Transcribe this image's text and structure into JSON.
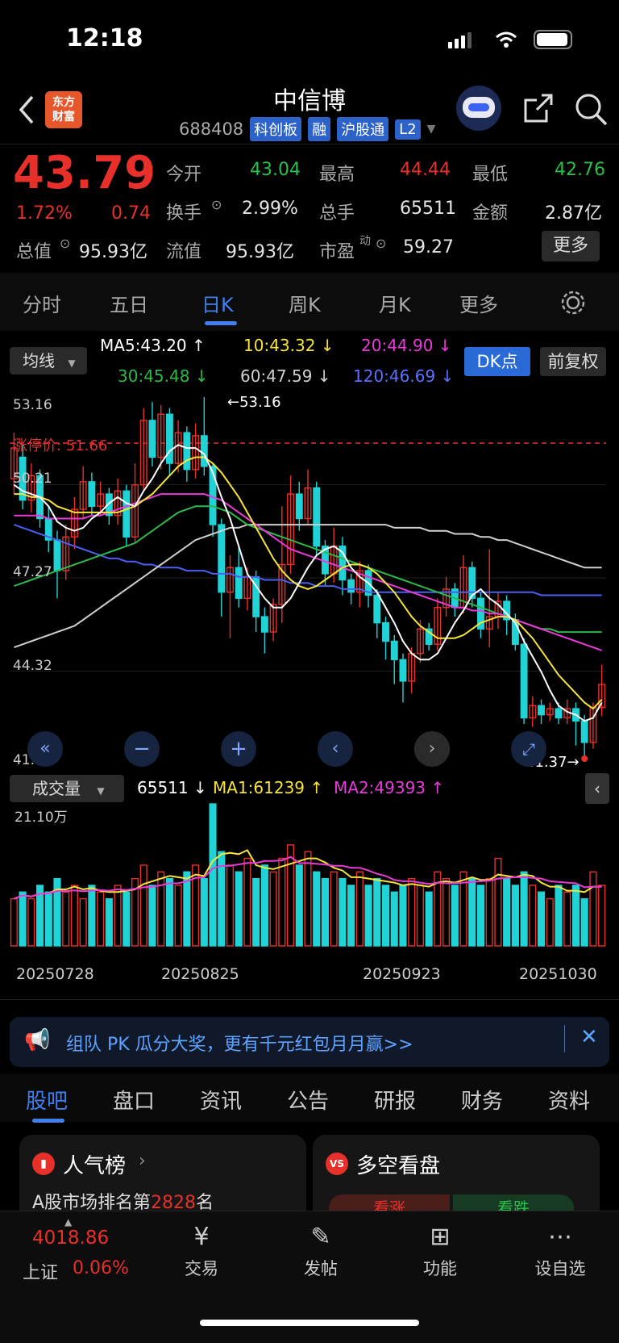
{
  "status": {
    "time": "12:18"
  },
  "header": {
    "title": "中信博",
    "code": "688408",
    "tags": [
      "科创板",
      "融",
      "沪股通",
      "L2"
    ],
    "logo_line1": "东方",
    "logo_line2": "财富"
  },
  "quote": {
    "price": "43.79",
    "change_pct": "1.72%",
    "change_abs": "0.74",
    "open_label": "今开",
    "open": "43.04",
    "high_label": "最高",
    "high": "44.44",
    "low_label": "最低",
    "low": "42.76",
    "turnover_label": "换手",
    "turnover": "2.99%",
    "volume_label": "总手",
    "volume": "65511",
    "amount_label": "金额",
    "amount": "2.87亿",
    "mktcap_label": "总值",
    "mktcap": "95.93亿",
    "float_label": "流值",
    "float": "95.93亿",
    "pe_label": "市盈",
    "pe_sup": "动",
    "pe": "59.27",
    "more_button": "更多"
  },
  "tabs": [
    "分时",
    "五日",
    "日K",
    "周K",
    "月K",
    "更多"
  ],
  "active_tab": "日K",
  "ma": {
    "selector": "均线",
    "ma5": "MA5:43.20",
    "ma10": "10:43.32",
    "ma20": "20:44.90",
    "ma30": "30:45.48",
    "ma60": "60:47.59",
    "ma120": "120:46.69",
    "dk_button": "DK点",
    "adjust_button": "前复权"
  },
  "price_axis": {
    "top": "53.16",
    "l2": "50.21",
    "l3": "47.27",
    "l4": "44.32",
    "bottom": "41.37"
  },
  "markers": {
    "high_note": "←53.16",
    "low_note": "41.37→",
    "limit_label": "涨停价:",
    "limit_value": "51.66"
  },
  "volume": {
    "selector": "成交量",
    "value": "65511",
    "ma1": "MA1:61239",
    "ma2": "MA2:49393",
    "scale": "21.10万"
  },
  "dates": [
    "20250728",
    "20250825",
    "20250923",
    "20251030"
  ],
  "ticker_text": "组队 PK 瓜分大奖，更有千元红包月月赢>>",
  "subtabs": [
    "股吧",
    "盘口",
    "资讯",
    "公告",
    "研报",
    "财务",
    "资料"
  ],
  "cards": {
    "popular_title": "人气榜",
    "popular_prefix": "A股市场排名第",
    "popular_rank": "2828",
    "popular_suffix": "名",
    "vs_title": "多空看盘",
    "vs_up": "看涨",
    "vs_down": "看跌"
  },
  "bottom_nav": {
    "index_value": "4018.86",
    "index_name": "上证",
    "index_change": "0.06%",
    "trade": "交易",
    "post": "发帖",
    "function": "功能",
    "watchlist": "设自选"
  },
  "chart_data": {
    "type": "candlestick",
    "y_range": [
      41.37,
      53.16
    ],
    "series": [
      {
        "o": 50.5,
        "c": 51.5,
        "h": 52.0,
        "l": 50.0
      },
      {
        "o": 51.2,
        "c": 49.8,
        "h": 51.6,
        "l": 49.5
      },
      {
        "o": 49.8,
        "c": 50.6,
        "h": 51.0,
        "l": 49.4
      },
      {
        "o": 50.6,
        "c": 49.2,
        "h": 50.8,
        "l": 48.9
      },
      {
        "o": 49.2,
        "c": 48.5,
        "h": 49.6,
        "l": 48.1
      },
      {
        "o": 48.5,
        "c": 47.5,
        "h": 48.8,
        "l": 46.6
      },
      {
        "o": 47.5,
        "c": 48.6,
        "h": 49.0,
        "l": 47.2
      },
      {
        "o": 48.6,
        "c": 49.5,
        "h": 49.9,
        "l": 48.2
      },
      {
        "o": 49.5,
        "c": 50.4,
        "h": 50.9,
        "l": 49.2
      },
      {
        "o": 50.4,
        "c": 49.6,
        "h": 50.7,
        "l": 49.3
      },
      {
        "o": 49.6,
        "c": 50.0,
        "h": 50.4,
        "l": 49.3
      },
      {
        "o": 50.0,
        "c": 49.3,
        "h": 50.2,
        "l": 49.0
      },
      {
        "o": 49.3,
        "c": 50.1,
        "h": 50.5,
        "l": 49.0
      },
      {
        "o": 50.1,
        "c": 48.6,
        "h": 50.3,
        "l": 48.3
      },
      {
        "o": 48.6,
        "c": 50.3,
        "h": 51.0,
        "l": 48.4
      },
      {
        "o": 50.3,
        "c": 52.4,
        "h": 52.8,
        "l": 50.1
      },
      {
        "o": 52.4,
        "c": 51.2,
        "h": 53.0,
        "l": 50.9
      },
      {
        "o": 51.2,
        "c": 52.6,
        "h": 52.9,
        "l": 50.8
      },
      {
        "o": 52.6,
        "c": 51.0,
        "h": 52.8,
        "l": 50.6
      },
      {
        "o": 51.0,
        "c": 52.0,
        "h": 52.4,
        "l": 50.7
      },
      {
        "o": 52.0,
        "c": 50.8,
        "h": 52.2,
        "l": 50.4
      },
      {
        "o": 50.8,
        "c": 51.9,
        "h": 52.3,
        "l": 50.5
      },
      {
        "o": 51.9,
        "c": 50.9,
        "h": 53.16,
        "l": 50.6
      },
      {
        "o": 50.9,
        "c": 49.0,
        "h": 51.0,
        "l": 48.6
      },
      {
        "o": 49.0,
        "c": 46.8,
        "h": 49.2,
        "l": 46.0
      },
      {
        "o": 46.8,
        "c": 47.6,
        "h": 48.0,
        "l": 45.3
      },
      {
        "o": 47.6,
        "c": 46.6,
        "h": 48.3,
        "l": 46.3
      },
      {
        "o": 46.6,
        "c": 47.3,
        "h": 47.6,
        "l": 46.2
      },
      {
        "o": 47.3,
        "c": 46.0,
        "h": 47.5,
        "l": 45.5
      },
      {
        "o": 46.0,
        "c": 45.5,
        "h": 46.3,
        "l": 44.8
      },
      {
        "o": 45.5,
        "c": 46.4,
        "h": 46.6,
        "l": 45.2
      },
      {
        "o": 46.4,
        "c": 47.7,
        "h": 49.6,
        "l": 45.8
      },
      {
        "o": 47.7,
        "c": 50.0,
        "h": 50.6,
        "l": 47.4
      },
      {
        "o": 50.0,
        "c": 49.2,
        "h": 50.4,
        "l": 48.8
      },
      {
        "o": 49.2,
        "c": 50.2,
        "h": 50.8,
        "l": 49.0
      },
      {
        "o": 50.2,
        "c": 48.3,
        "h": 50.4,
        "l": 48.0
      },
      {
        "o": 48.3,
        "c": 47.4,
        "h": 48.5,
        "l": 47.0
      },
      {
        "o": 47.4,
        "c": 48.3,
        "h": 48.9,
        "l": 47.1
      },
      {
        "o": 48.3,
        "c": 47.2,
        "h": 48.6,
        "l": 46.7
      },
      {
        "o": 47.2,
        "c": 46.8,
        "h": 47.4,
        "l": 46.4
      },
      {
        "o": 46.8,
        "c": 47.5,
        "h": 47.8,
        "l": 46.3
      },
      {
        "o": 47.5,
        "c": 46.7,
        "h": 47.7,
        "l": 46.3
      },
      {
        "o": 46.7,
        "c": 45.8,
        "h": 46.9,
        "l": 45.3
      },
      {
        "o": 45.8,
        "c": 45.2,
        "h": 46.0,
        "l": 44.6
      },
      {
        "o": 45.2,
        "c": 44.6,
        "h": 45.4,
        "l": 43.8
      },
      {
        "o": 44.6,
        "c": 43.9,
        "h": 44.8,
        "l": 43.2
      },
      {
        "o": 43.9,
        "c": 44.8,
        "h": 45.0,
        "l": 43.5
      },
      {
        "o": 44.8,
        "c": 45.6,
        "h": 45.9,
        "l": 44.5
      },
      {
        "o": 45.6,
        "c": 45.1,
        "h": 45.8,
        "l": 44.9
      },
      {
        "o": 45.1,
        "c": 46.3,
        "h": 46.6,
        "l": 44.9
      },
      {
        "o": 46.3,
        "c": 46.9,
        "h": 47.3,
        "l": 46.0
      },
      {
        "o": 46.9,
        "c": 46.3,
        "h": 47.1,
        "l": 46.0
      },
      {
        "o": 46.3,
        "c": 47.6,
        "h": 48.0,
        "l": 46.1
      },
      {
        "o": 47.6,
        "c": 46.6,
        "h": 47.8,
        "l": 46.3
      },
      {
        "o": 46.6,
        "c": 45.6,
        "h": 46.8,
        "l": 45.3
      },
      {
        "o": 45.6,
        "c": 46.0,
        "h": 48.2,
        "l": 45.0
      },
      {
        "o": 46.0,
        "c": 46.5,
        "h": 46.8,
        "l": 45.6
      },
      {
        "o": 46.5,
        "c": 45.9,
        "h": 46.7,
        "l": 45.4
      },
      {
        "o": 45.9,
        "c": 45.1,
        "h": 46.1,
        "l": 44.9
      },
      {
        "o": 45.1,
        "c": 42.7,
        "h": 45.3,
        "l": 42.5
      },
      {
        "o": 42.7,
        "c": 43.1,
        "h": 43.4,
        "l": 42.4
      },
      {
        "o": 43.1,
        "c": 42.8,
        "h": 43.3,
        "l": 42.5
      },
      {
        "o": 42.8,
        "c": 43.0,
        "h": 43.2,
        "l": 42.6
      },
      {
        "o": 43.0,
        "c": 42.7,
        "h": 43.2,
        "l": 42.5
      },
      {
        "o": 42.7,
        "c": 43.0,
        "h": 43.3,
        "l": 42.5
      },
      {
        "o": 43.0,
        "c": 42.6,
        "h": 43.2,
        "l": 41.8
      },
      {
        "o": 42.6,
        "c": 41.9,
        "h": 42.8,
        "l": 41.37
      },
      {
        "o": 41.9,
        "c": 43.04,
        "h": 43.2,
        "l": 41.7
      },
      {
        "o": 43.04,
        "c": 43.79,
        "h": 44.44,
        "l": 42.76
      }
    ],
    "volumes": [
      7,
      8,
      7,
      9,
      8,
      10,
      8,
      9,
      7,
      9,
      8,
      7,
      9,
      8,
      10,
      12,
      9,
      11,
      10,
      9,
      11,
      12,
      10,
      21.1,
      14,
      12,
      11,
      13,
      10,
      12,
      11,
      13,
      15,
      12,
      14,
      11,
      10,
      11,
      10,
      9,
      11,
      9,
      10,
      9,
      8,
      9,
      10,
      9,
      8,
      11,
      10,
      9,
      11,
      10,
      9,
      10,
      13,
      10,
      9,
      11,
      9,
      8,
      7,
      9,
      8,
      9,
      7,
      11,
      9
    ],
    "ma_lines": {
      "ma5": [
        50.3,
        50.1,
        50.0,
        49.9,
        49.6,
        49.1,
        48.9,
        48.8,
        48.9,
        49.2,
        49.4,
        49.7,
        49.9,
        49.7,
        49.6,
        50.1,
        50.5,
        51.0,
        51.4,
        51.6,
        51.5,
        51.5,
        51.3,
        50.7,
        49.9,
        49.2,
        48.3,
        47.4,
        47.0,
        46.6,
        46.3,
        46.3,
        46.6,
        47.1,
        47.6,
        48.0,
        48.2,
        48.3,
        48.1,
        47.6,
        47.3,
        47.1,
        46.8,
        46.3,
        45.8,
        45.2,
        44.8,
        44.6,
        44.6,
        44.8,
        45.3,
        45.8,
        46.2,
        46.7,
        46.9,
        46.6,
        46.4,
        46.1,
        45.8,
        45.2,
        44.7,
        44.2,
        43.6,
        43.1,
        42.9,
        42.8,
        42.6,
        42.7,
        43.2
      ],
      "ma10": [
        50.0,
        50.0,
        49.9,
        49.9,
        49.8,
        49.6,
        49.5,
        49.4,
        49.4,
        49.4,
        49.4,
        49.4,
        49.4,
        49.5,
        49.6,
        49.8,
        50.0,
        50.3,
        50.6,
        50.9,
        51.1,
        51.2,
        51.2,
        51.0,
        50.7,
        50.3,
        49.9,
        49.4,
        48.9,
        48.4,
        47.9,
        47.5,
        47.2,
        47.0,
        46.9,
        47.0,
        47.2,
        47.4,
        47.6,
        47.7,
        47.7,
        47.6,
        47.4,
        47.1,
        46.8,
        46.4,
        46.0,
        45.7,
        45.5,
        45.3,
        45.3,
        45.3,
        45.4,
        45.6,
        45.8,
        45.9,
        46.0,
        46.0,
        45.9,
        45.6,
        45.3,
        44.9,
        44.5,
        44.1,
        43.8,
        43.5,
        43.2,
        43.0,
        43.3
      ],
      "ma20": [
        49.3,
        49.3,
        49.3,
        49.3,
        49.2,
        49.2,
        49.2,
        49.2,
        49.2,
        49.3,
        49.3,
        49.4,
        49.5,
        49.6,
        49.7,
        49.8,
        49.9,
        50.0,
        50.0,
        50.0,
        50.0,
        50.0,
        50.0,
        49.9,
        49.8,
        49.6,
        49.4,
        49.2,
        49.0,
        48.8,
        48.6,
        48.4,
        48.2,
        48.1,
        48.0,
        47.9,
        47.8,
        47.7,
        47.6,
        47.5,
        47.4,
        47.3,
        47.2,
        47.1,
        47.0,
        46.9,
        46.8,
        46.7,
        46.6,
        46.5,
        46.4,
        46.3,
        46.3,
        46.2,
        46.2,
        46.1,
        46.1,
        46.0,
        45.9,
        45.8,
        45.7,
        45.6,
        45.5,
        45.4,
        45.3,
        45.2,
        45.1,
        45.0,
        44.9
      ],
      "ma30": [
        47.0,
        47.1,
        47.2,
        47.3,
        47.4,
        47.5,
        47.6,
        47.7,
        47.8,
        47.9,
        48.0,
        48.1,
        48.2,
        48.3,
        48.4,
        48.6,
        48.8,
        49.0,
        49.2,
        49.4,
        49.5,
        49.6,
        49.6,
        49.6,
        49.5,
        49.4,
        49.2,
        49.0,
        48.9,
        48.8,
        48.7,
        48.6,
        48.5,
        48.4,
        48.3,
        48.2,
        48.1,
        48.0,
        47.9,
        47.8,
        47.7,
        47.6,
        47.5,
        47.4,
        47.3,
        47.2,
        47.1,
        47.0,
        46.9,
        46.8,
        46.7,
        46.6,
        46.5,
        46.4,
        46.3,
        46.2,
        46.1,
        46.0,
        45.9,
        45.8,
        45.7,
        45.6,
        45.6,
        45.5,
        45.5,
        45.5,
        45.5,
        45.5,
        45.5
      ],
      "ma60": [
        45.0,
        45.1,
        45.2,
        45.3,
        45.4,
        45.5,
        45.6,
        45.7,
        45.9,
        46.1,
        46.3,
        46.5,
        46.7,
        46.9,
        47.1,
        47.3,
        47.5,
        47.7,
        47.9,
        48.1,
        48.3,
        48.5,
        48.6,
        48.7,
        48.8,
        48.9,
        48.9,
        49.0,
        49.0,
        49.0,
        49.0,
        49.0,
        49.0,
        49.0,
        49.0,
        49.0,
        49.0,
        49.0,
        49.0,
        49.0,
        49.0,
        49.0,
        49.0,
        49.0,
        48.9,
        48.9,
        48.9,
        48.9,
        48.8,
        48.8,
        48.8,
        48.7,
        48.7,
        48.7,
        48.6,
        48.6,
        48.5,
        48.5,
        48.4,
        48.3,
        48.2,
        48.1,
        48.0,
        47.9,
        47.8,
        47.7,
        47.6,
        47.6,
        47.6
      ],
      "ma120": [
        49.0,
        48.9,
        48.8,
        48.7,
        48.6,
        48.5,
        48.4,
        48.3,
        48.2,
        48.1,
        48.0,
        47.9,
        47.9,
        47.8,
        47.8,
        47.7,
        47.7,
        47.6,
        47.6,
        47.6,
        47.5,
        47.5,
        47.5,
        47.4,
        47.4,
        47.4,
        47.3,
        47.3,
        47.3,
        47.2,
        47.2,
        47.2,
        47.1,
        47.1,
        47.1,
        47.0,
        47.0,
        47.0,
        46.9,
        46.9,
        46.9,
        46.8,
        46.8,
        46.8,
        46.8,
        46.8,
        46.8,
        46.8,
        46.8,
        46.8,
        46.8,
        46.8,
        46.8,
        46.8,
        46.8,
        46.8,
        46.8,
        46.8,
        46.8,
        46.8,
        46.8,
        46.7,
        46.7,
        46.7,
        46.7,
        46.7,
        46.7,
        46.7,
        46.7
      ]
    },
    "colors": {
      "up": "#e8302a",
      "down": "#1fd3d6",
      "ma5": "#ffffff",
      "ma10": "#f7e43a",
      "ma20": "#e83ad8",
      "ma30": "#2fb84a",
      "ma60": "#cfcfcf",
      "ma120": "#4b5ff0"
    }
  }
}
